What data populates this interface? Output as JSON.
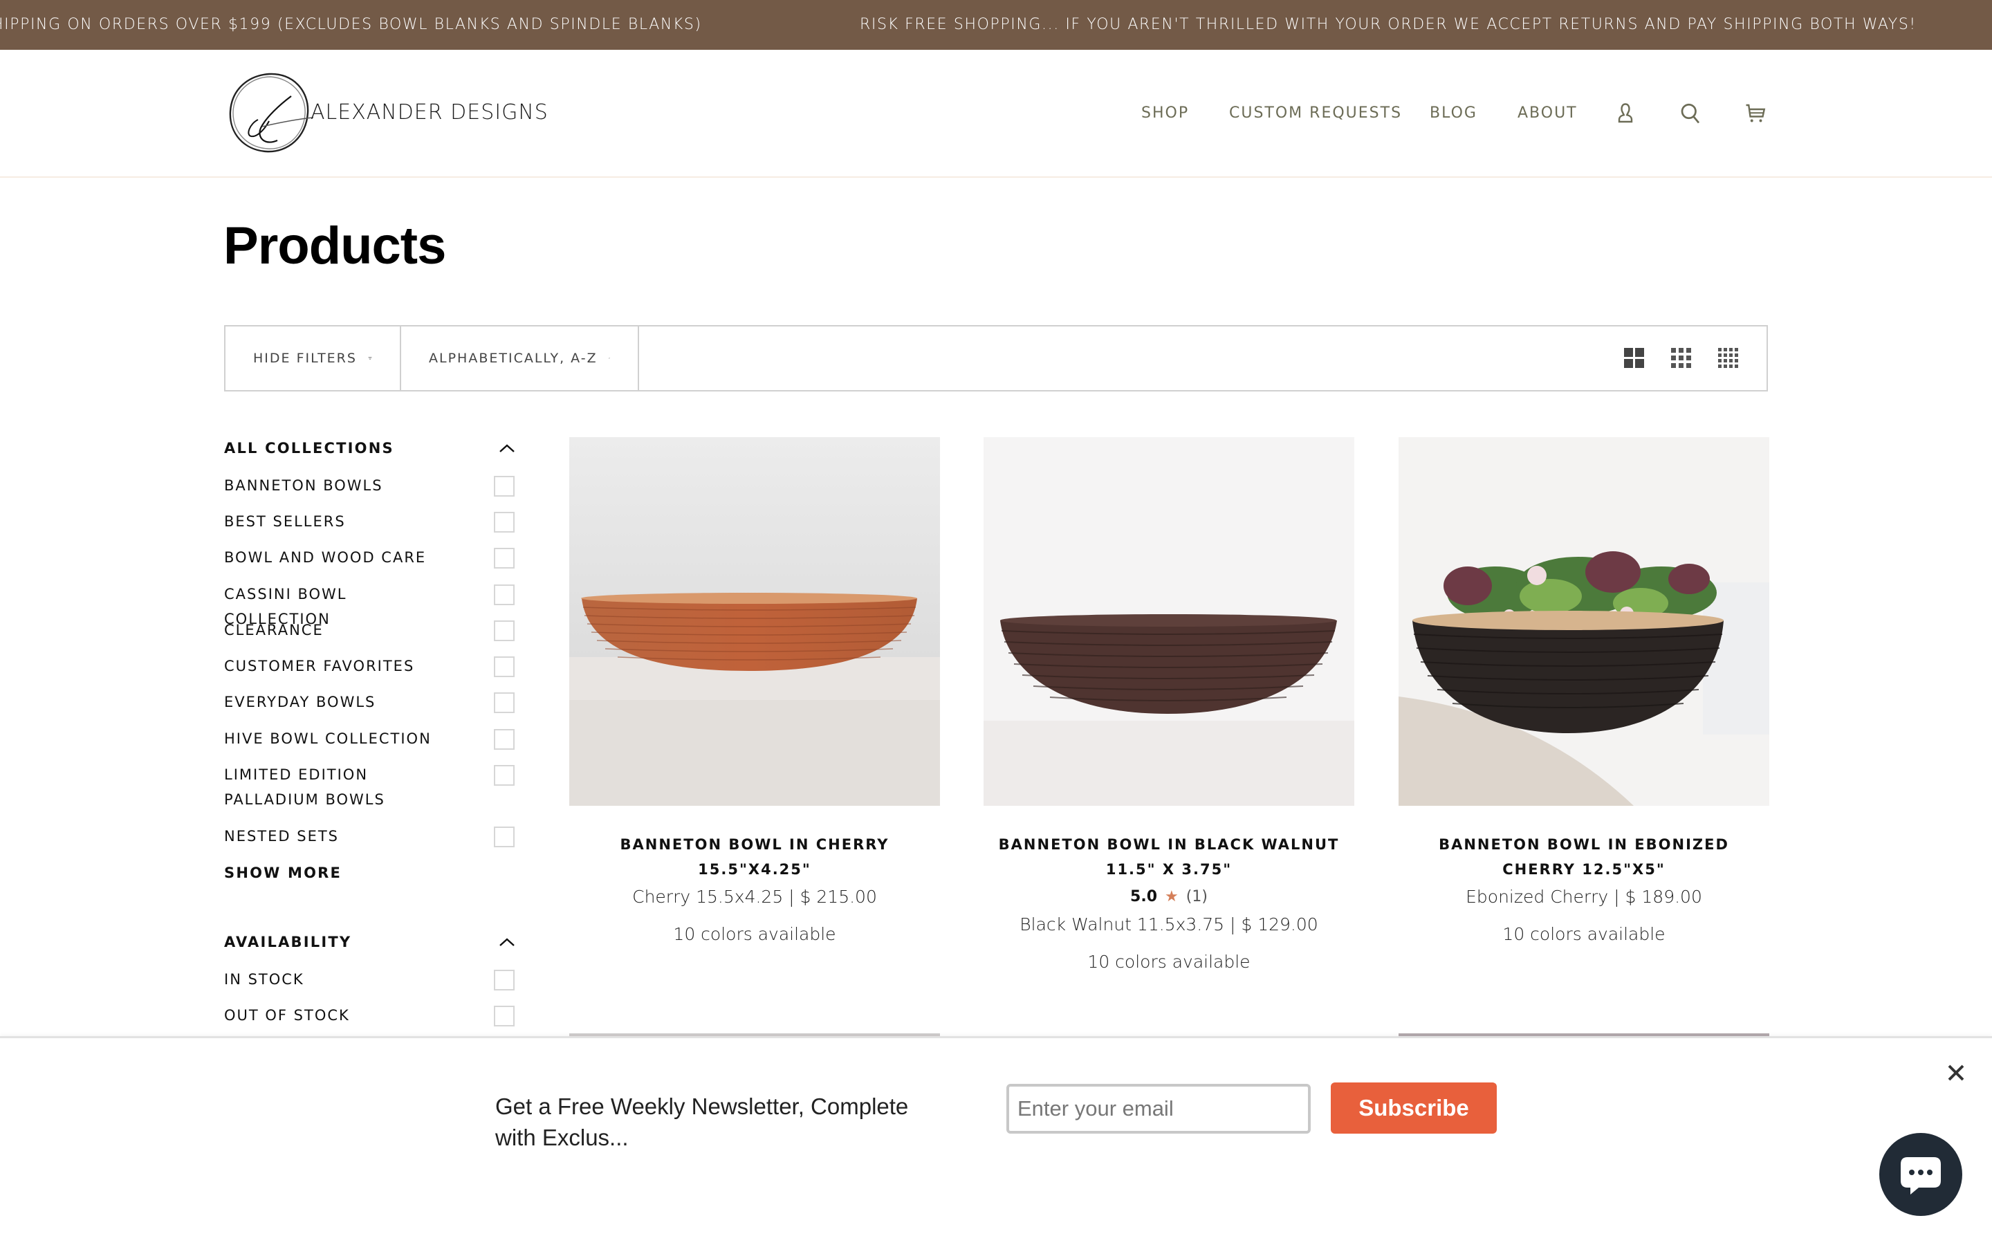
{
  "announcement": {
    "message_1": "HIPPING ON ORDERS OVER $199 (EXCLUDES BOWL BLANKS AND SPINDLE BLANKS)",
    "message_2": "RISK FREE SHOPPING... IF YOU AREN'T THRILLED WITH YOUR ORDER WE ACCEPT RETURNS AND PAY SHIPPING BOTH WAYS!",
    "background_color": "#735a47"
  },
  "header": {
    "logo_text": "ALEXANDER DESIGNS",
    "nav": [
      {
        "label": "SHOP"
      },
      {
        "label": "CUSTOM REQUESTS"
      },
      {
        "label": "BLOG"
      },
      {
        "label": "ABOUT"
      }
    ],
    "icons": [
      "account-icon",
      "search-icon",
      "cart-icon"
    ],
    "nav_color": "#6c6c56"
  },
  "page": {
    "title": "Products"
  },
  "toolbar": {
    "hide_filters_label": "HIDE FILTERS",
    "sort_label": "ALPHABETICALLY, A-Z",
    "grid_options": [
      "grid-2-icon",
      "grid-3-icon",
      "grid-4-icon"
    ]
  },
  "filters": {
    "collections": {
      "title": "ALL COLLECTIONS",
      "items": [
        {
          "label": "BANNETON BOWLS",
          "checked": false
        },
        {
          "label": "BEST SELLERS",
          "checked": false
        },
        {
          "label": "BOWL AND WOOD CARE",
          "checked": false
        },
        {
          "label": "CASSINI BOWL COLLECTION",
          "checked": false
        },
        {
          "label": "CLEARANCE",
          "checked": false
        },
        {
          "label": "CUSTOMER FAVORITES",
          "checked": false
        },
        {
          "label": "EVERYDAY BOWLS",
          "checked": false
        },
        {
          "label": "HIVE BOWL COLLECTION",
          "checked": false
        },
        {
          "label": "LIMITED EDITION PALLADIUM BOWLS",
          "checked": false
        },
        {
          "label": "NESTED SETS",
          "checked": false
        }
      ],
      "show_more_label": "SHOW MORE"
    },
    "availability": {
      "title": "AVAILABILITY",
      "items": [
        {
          "label": "IN STOCK",
          "checked": false
        },
        {
          "label": "OUT OF STOCK",
          "checked": false
        }
      ]
    }
  },
  "products": [
    {
      "title": "BANNETON BOWL IN CHERRY 15.5\"X4.25\"",
      "price_line": "Cherry 15.5x4.25 | $ 215.00",
      "colors": "10 colors available",
      "rating": null
    },
    {
      "title": "BANNETON BOWL IN BLACK WALNUT 11.5\" X 3.75\"",
      "rating": {
        "score": "5.0",
        "star": "★",
        "count": "(1)"
      },
      "price_line": "Black Walnut 11.5x3.75 | $ 129.00",
      "colors": "10 colors available"
    },
    {
      "title": "BANNETON BOWL IN EBONIZED CHERRY 12.5\"X5\"",
      "price_line": "Ebonized Cherry | $ 189.00",
      "colors": "10 colors available",
      "rating": null
    }
  ],
  "newsletter": {
    "text": "Get a Free Weekly Newsletter, Complete with Exclus...",
    "email_placeholder": "Enter your email",
    "email_value": "",
    "subscribe_label": "Subscribe",
    "button_color": "#e8603c"
  },
  "chat": {
    "icon": "chat-bubble-icon",
    "color": "#212b36"
  }
}
